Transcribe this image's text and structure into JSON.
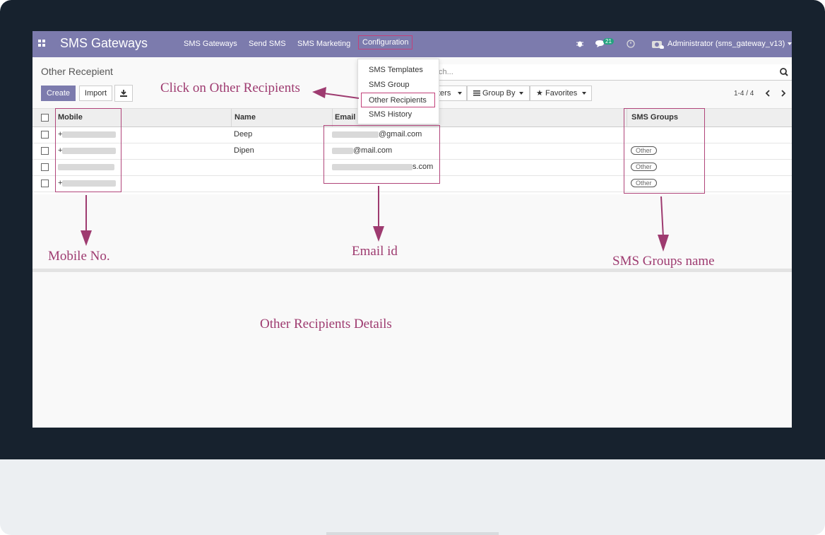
{
  "app": {
    "title": "SMS Gateways"
  },
  "navbar": {
    "menu": [
      {
        "label": "SMS Gateways"
      },
      {
        "label": "Send SMS"
      },
      {
        "label": "SMS Marketing"
      },
      {
        "label": "Configuration"
      }
    ],
    "chat_badge": "21",
    "user": "Administrator (sms_gateway_v13)"
  },
  "configuration_menu": [
    {
      "label": "SMS Templates"
    },
    {
      "label": "SMS Group"
    },
    {
      "label": "Other Recipients"
    },
    {
      "label": "SMS History"
    }
  ],
  "control_panel": {
    "breadcrumb": "Other Recepient",
    "create_label": "Create",
    "import_label": "Import",
    "search_placeholder": "ch...",
    "filters_label": "ters",
    "groupby_label": "Group By",
    "favorites_label": "Favorites",
    "pager": "1-4 / 4"
  },
  "table": {
    "columns": {
      "mobile": "Mobile",
      "name": "Name",
      "email": "Email",
      "groups": "SMS Groups"
    },
    "rows": [
      {
        "mobile_prefix": "+",
        "name": "Deep",
        "email_suffix": "@gmail.com",
        "group": ""
      },
      {
        "mobile_prefix": "+",
        "name": "Dipen",
        "email_suffix": "@mail.com",
        "group": "Other"
      },
      {
        "mobile_prefix": "",
        "name": "",
        "email_suffix": "s.com",
        "group": "Other"
      },
      {
        "mobile_prefix": "+",
        "name": "",
        "email_suffix": "",
        "group": "Other"
      }
    ]
  },
  "annotations": {
    "click_other": "Click on Other Recipients",
    "mobile": "Mobile No.",
    "email": "Email id",
    "groups": "SMS Groups name",
    "details": "Other Recipients Details"
  },
  "colors": {
    "navbar": "#7c7bad",
    "annotation": "#9e3b70",
    "bezel": "#17222e"
  }
}
